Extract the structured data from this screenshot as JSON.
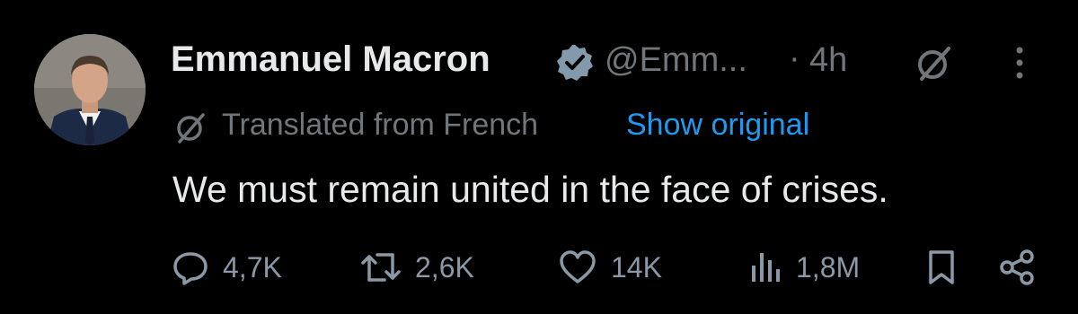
{
  "tweet": {
    "author_name": "Emmanuel Macron",
    "handle": "@Emm...",
    "separator": "·",
    "time": "4h",
    "verified": true,
    "translation_label": "Translated from French",
    "show_original_label": "Show original",
    "text": "We must remain united in the face of crises."
  },
  "actions": {
    "replies": "4,7K",
    "reposts": "2,6K",
    "likes": "14K",
    "views": "1,8M"
  },
  "icons": [
    "verified-badge-icon",
    "grok-icon",
    "more-icon",
    "translate-icon",
    "reply-icon",
    "repost-icon",
    "like-icon",
    "views-icon",
    "bookmark-icon",
    "share-icon"
  ],
  "colors": {
    "background": "#000000",
    "primary_text": "#e7e9ea",
    "secondary_text": "#71767b",
    "link": "#1d9bf0",
    "action_icons": "#8b98a5"
  }
}
